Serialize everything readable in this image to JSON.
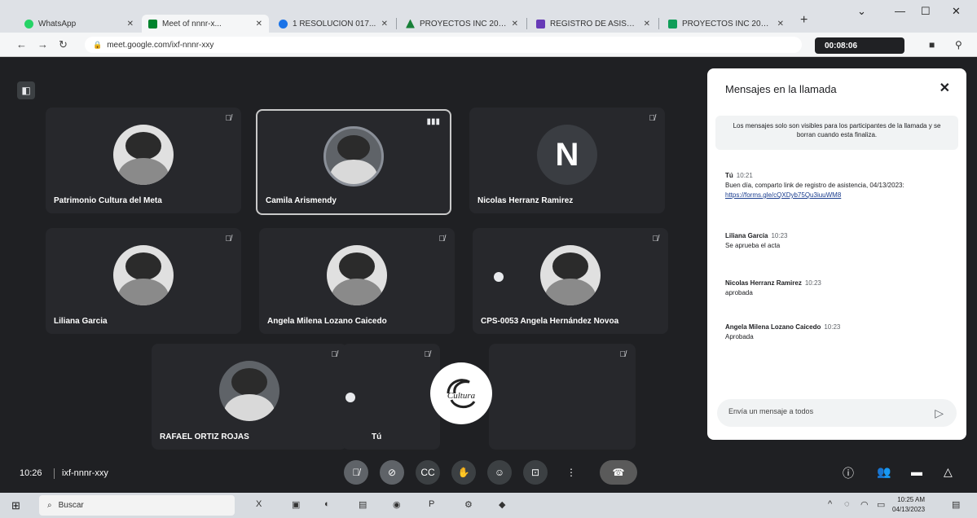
{
  "browser": {
    "tabs": [
      {
        "label": "WhatsApp",
        "favicon_color": "#25d366"
      },
      {
        "label": "Meet of nnnr-x...",
        "favicon_color": "#00832d"
      },
      {
        "label": "1 RESOLUCION 017...",
        "favicon_color": "#1a73e8"
      },
      {
        "label": "PROYECTOS INC 202...",
        "favicon_color": "#188038"
      },
      {
        "label": "REGISTRO DE ASISTI...",
        "favicon_color": "#673ab7"
      },
      {
        "label": "PROYECTOS INC 202...",
        "favicon_color": "#0f9d58"
      }
    ],
    "url": "meet.google.com/ixf-nnnr-xxy",
    "call_timer": "00:08:06"
  },
  "participants": [
    {
      "name": "Patrimonio Cultura del Meta",
      "avatar": "photo",
      "status": "muted"
    },
    {
      "name": "Camila Arismendy",
      "avatar": "photo",
      "status": "speaking"
    },
    {
      "name": "Nicolas Herranz Ramirez",
      "avatar": "N",
      "status": "muted"
    },
    {
      "name": "Liliana Garcia",
      "avatar": "photo",
      "status": "muted"
    },
    {
      "name": "Angela Milena Lozano Caicedo",
      "avatar": "photo",
      "status": "muted"
    },
    {
      "name": "CPS-0053 Angela Hernández Novoa",
      "avatar": "photo",
      "status": "muted"
    },
    {
      "name": "RAFAEL ORTIZ ROJAS",
      "avatar": "photo",
      "status": "muted"
    },
    {
      "name": "Tú",
      "avatar": "none",
      "status": "muted"
    },
    {
      "name": "",
      "avatar": "logo",
      "status": "muted"
    }
  ],
  "chat": {
    "title": "Mensajes en la llamada",
    "notice": "Los mensajes solo son visibles para los participantes de la llamada y se borran cuando esta finaliza.",
    "messages": [
      {
        "sender": "Tú",
        "time": "10:21",
        "text": "Buen día, comparto link de registro de asistencia, 04/13/2023:",
        "link": "https://forms.gle/cQXDyb75Qu3iuuWM8"
      },
      {
        "sender": "Liliana García",
        "time": "10:23",
        "text": "Se aprueba el acta"
      },
      {
        "sender": "Nicolas Herranz Ramirez",
        "time": "10:23",
        "text": "aprobada"
      },
      {
        "sender": "Angela Milena Lozano Caicedo",
        "time": "10:23",
        "text": "Aprobada"
      }
    ],
    "input_placeholder": "Envía un mensaje a todos"
  },
  "meeting": {
    "time": "10:26",
    "code": "ixf-nnnr-xxy"
  },
  "taskbar": {
    "search_label": "Buscar",
    "time": "10:25 AM",
    "date": "04/13/2023"
  },
  "logo": {
    "text": "Cultura"
  }
}
